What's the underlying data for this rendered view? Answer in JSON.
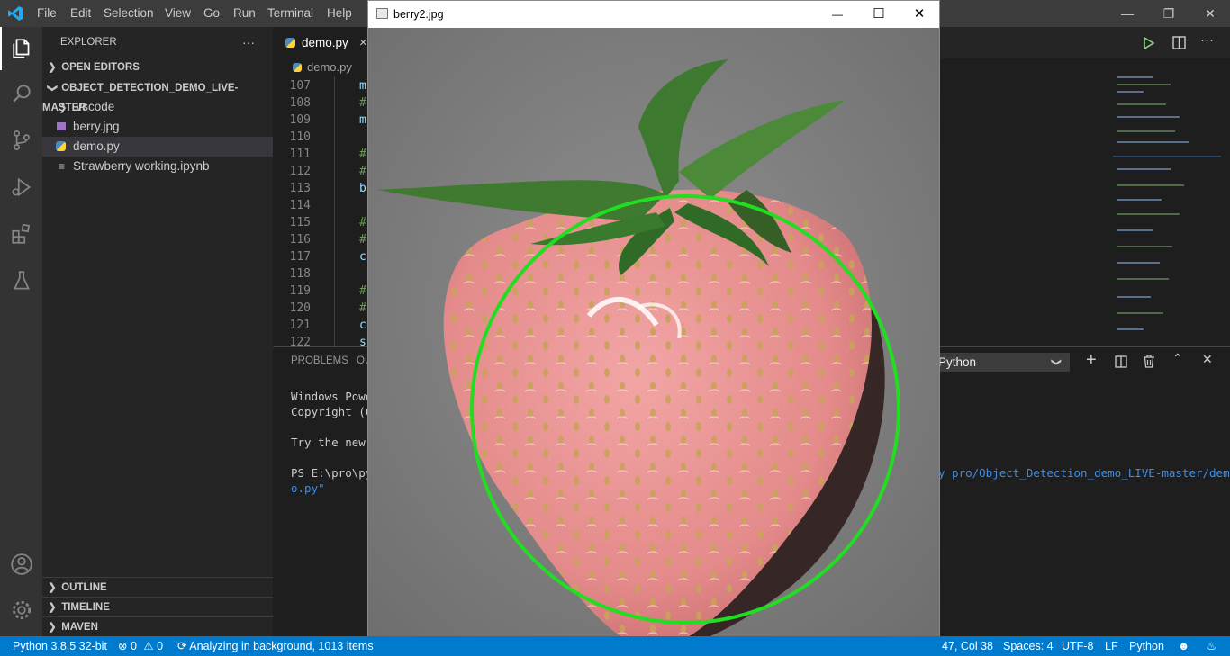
{
  "titlebar": {
    "menu": [
      "File",
      "Edit",
      "Selection",
      "View",
      "Go",
      "Run",
      "Terminal",
      "Help"
    ]
  },
  "activitybar": {
    "icons": [
      "files-icon",
      "search-icon",
      "source-control-icon",
      "run-debug-icon",
      "extensions-icon",
      "testing-icon",
      "account-icon",
      "settings-gear-icon"
    ]
  },
  "sidebar": {
    "title": "EXPLORER",
    "more": "···",
    "open_editors": "OPEN EDITORS",
    "project": "OBJECT_DETECTION_DEMO_LIVE-MASTER",
    "files": [
      ".vscode",
      "berry.jpg",
      "demo.py",
      "Strawberry working.ipynb"
    ],
    "outline": "OUTLINE",
    "timeline": "TIMELINE",
    "maven": "MAVEN"
  },
  "editor": {
    "tab": "demo.py",
    "tab_close": "×",
    "breadcrumb": "demo.py",
    "lines": [
      {
        "num": "107",
        "text": "m"
      },
      {
        "num": "108",
        "text": "#"
      },
      {
        "num": "109",
        "text": "m"
      },
      {
        "num": "110",
        "text": ""
      },
      {
        "num": "111",
        "text": "#"
      },
      {
        "num": "112",
        "text": "#"
      },
      {
        "num": "113",
        "text": "b"
      },
      {
        "num": "114",
        "text": ""
      },
      {
        "num": "115",
        "text": "#"
      },
      {
        "num": "116",
        "text": "#"
      },
      {
        "num": "117",
        "text": "c"
      },
      {
        "num": "118",
        "text": ""
      },
      {
        "num": "119",
        "text": "#"
      },
      {
        "num": "120",
        "text": "#"
      },
      {
        "num": "121",
        "text": "c"
      },
      {
        "num": "122",
        "text": "s"
      }
    ]
  },
  "panel": {
    "tabs": [
      "PROBLEMS",
      "OU"
    ],
    "terminal_lines": [
      "Windows Powe",
      "Copyright (C",
      "",
      "Try the new ",
      "",
      "PS E:\\pro\\py"
    ],
    "terminal_path_1": "y pro/Object_Detection_demo_LIVE-master/dem",
    "terminal_path_2": "o.py\"",
    "shell": "Python"
  },
  "image_window": {
    "title": "berry2.jpg",
    "minimize": "—",
    "maximize": "☐",
    "close": "✕"
  },
  "statusbar": {
    "python": "Python 3.8.5 32-bit",
    "errors": "0",
    "warnings": "0",
    "analyzing": "Analyzing in background, 1013 items",
    "position": "47, Col 38",
    "spaces": "Spaces: 4",
    "encoding": "UTF-8",
    "eol": "LF",
    "language": "Python"
  },
  "colors": {
    "accent": "#007acc",
    "circle": "#22dd22",
    "berry": "#e98f8f"
  }
}
